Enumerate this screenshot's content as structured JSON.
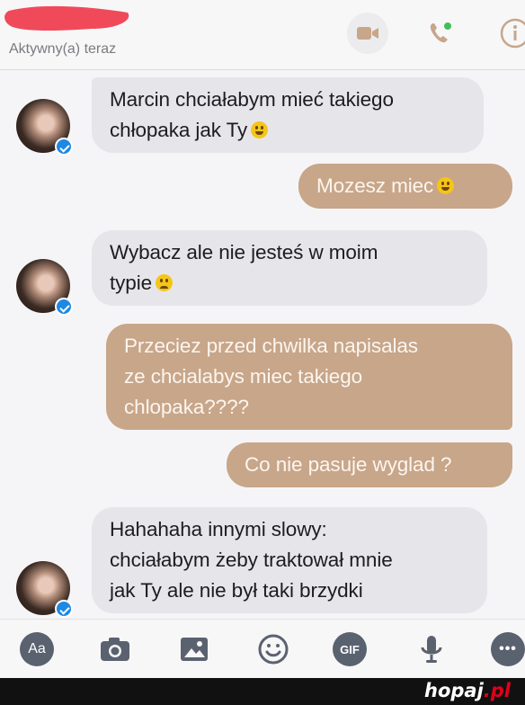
{
  "header": {
    "status": "Aktywny(a) teraz",
    "icons": [
      "video-camera-icon",
      "phone-icon",
      "info-icon"
    ],
    "accent": "#c7a68a"
  },
  "messages": [
    {
      "side": "in",
      "lines": [
        "Marcin chciałabym mieć takiego",
        "chłopaka jak Ty"
      ],
      "emoji": "laughing-emoji"
    },
    {
      "side": "out",
      "lines": [
        "Mozesz miec"
      ],
      "emoji": "smiling-emoji"
    },
    {
      "side": "in",
      "lines": [
        "Wybacz ale nie jesteś w moim",
        "typie"
      ],
      "emoji": "disappointed-emoji"
    },
    {
      "side": "out",
      "lines": [
        "Przeciez przed chwilka napisalas",
        "ze chcialabys miec takiego",
        "chlopaka????"
      ]
    },
    {
      "side": "out",
      "lines": [
        "Co nie pasuje wyglad ?"
      ]
    },
    {
      "side": "in",
      "lines": [
        "Hahahaha innymi slowy:",
        "chciałabym żeby traktował mnie",
        "jak Ty ale nie był taki brzydki"
      ]
    }
  ],
  "composer": {
    "aa_label": "Aa",
    "gif_label": "GIF",
    "more_label": "•••",
    "icons": [
      "text-format-icon",
      "camera-icon",
      "gallery-icon",
      "emoji-icon",
      "gif-icon",
      "microphone-icon",
      "more-icon"
    ]
  },
  "watermark": {
    "part1": "hopaj",
    "part2": ".pl"
  },
  "colors": {
    "incoming": "#e6e6ea",
    "outgoing": "#c7a68a",
    "icon": "#5a6270"
  }
}
